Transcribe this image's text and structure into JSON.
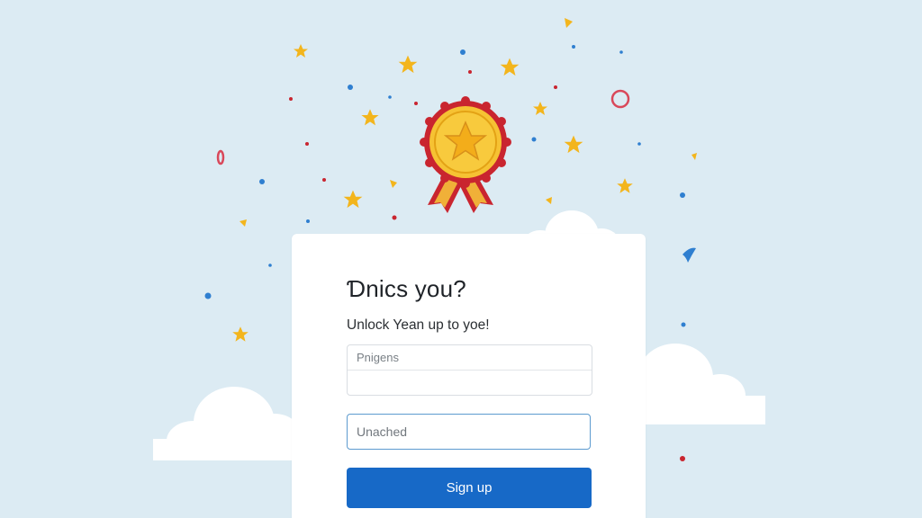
{
  "colors": {
    "background": "#dcebf3",
    "card": "#ffffff",
    "primary_button": "#1769c7",
    "focus_border": "#5d9bcf",
    "medal_gold": "#f3b51c",
    "ribbon_red": "#c9252f"
  },
  "decoration": {
    "medal_icon": "award-medal-star-icon",
    "confetti": "confetti-stars-dots"
  },
  "form": {
    "title": "Ɗnics you?",
    "subtitle": "Unlock Yean up to yoe!",
    "field_group_top_placeholder": "Pnigens",
    "field_group_bottom_placeholder": "",
    "single_field_placeholder": "Unached",
    "signup_label": "Sign up"
  }
}
